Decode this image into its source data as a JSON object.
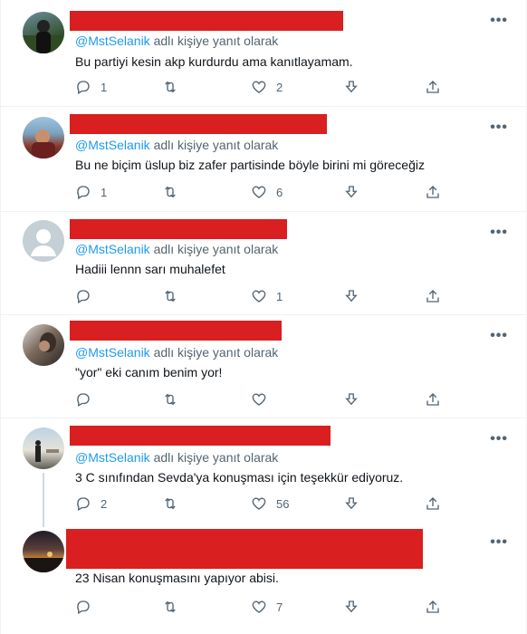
{
  "common": {
    "reply_prefix": "@MstSelanik",
    "reply_suffix": " adlı kişiye yanıt olarak",
    "more": "•••"
  },
  "tweets": [
    {
      "text": "Bu partiyi kesin akp kurdurdu ama kanıtlayamam.",
      "replies": "1",
      "retweets": "",
      "likes": "2"
    },
    {
      "text": "Bu ne biçim üslup biz zafer partisinde böyle birini mi göreceğiz",
      "replies": "1",
      "retweets": "",
      "likes": "6"
    },
    {
      "text": "Hadiii lennn sarı muhalefet",
      "replies": "",
      "retweets": "",
      "likes": "1"
    },
    {
      "text": "\"yor\" eki canım benim yor!",
      "replies": "",
      "retweets": "",
      "likes": ""
    },
    {
      "text": "3 C sınıfından Sevda'ya konuşması için teşekkür ediyoruz.",
      "replies": "2",
      "retweets": "",
      "likes": "56"
    },
    {
      "text": "23 Nisan konuşmasını yapıyor abisi.",
      "replies": "",
      "retweets": "",
      "likes": "7"
    }
  ],
  "icons": [
    "reply-icon",
    "retweet-icon",
    "like-icon",
    "download-icon",
    "share-icon",
    "more-icon"
  ],
  "colors": {
    "link": "#1d9bf0",
    "muted": "#536471",
    "redaction": "#d91f1f"
  }
}
